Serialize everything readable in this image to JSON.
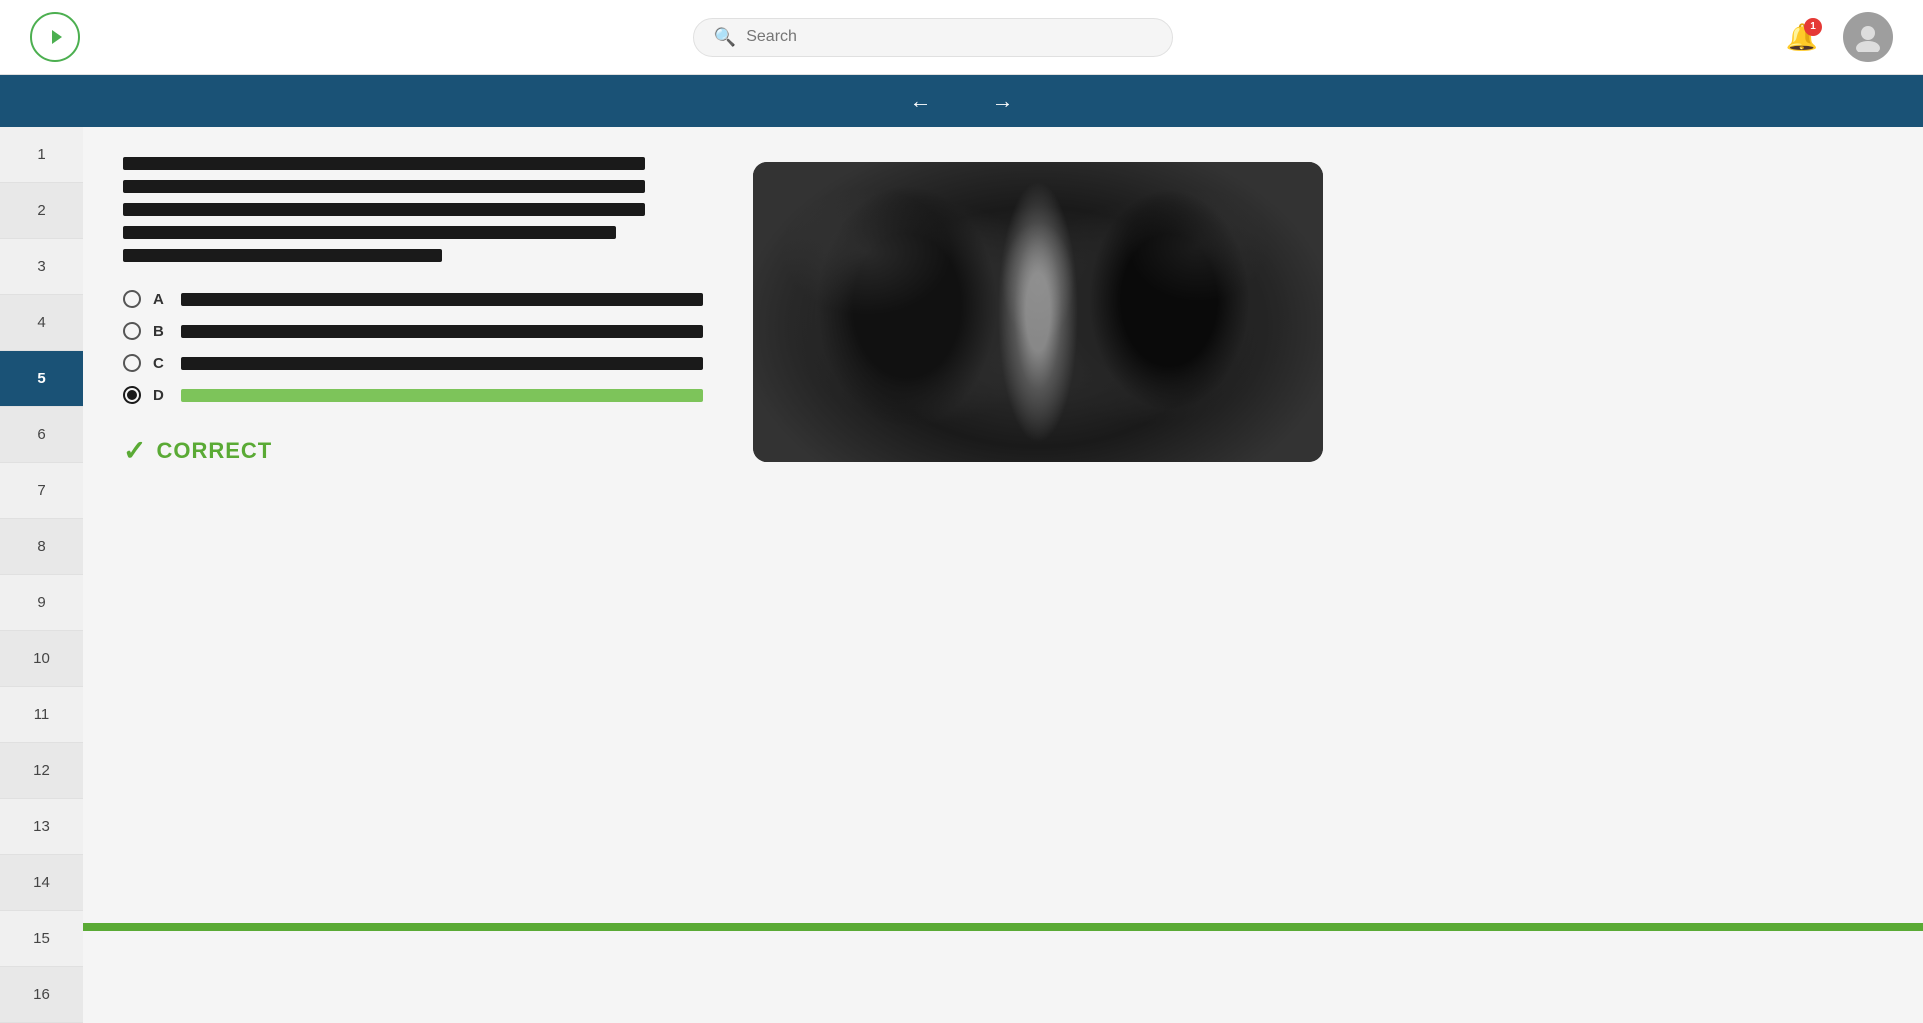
{
  "header": {
    "logo_icon": "play-icon",
    "search_placeholder": "Search",
    "notification_count": "1",
    "avatar_icon": "user-icon"
  },
  "nav": {
    "back_arrow": "←",
    "forward_arrow": "→"
  },
  "sidebar": {
    "items": [
      {
        "number": "1",
        "active": false
      },
      {
        "number": "2",
        "active": false
      },
      {
        "number": "3",
        "active": false
      },
      {
        "number": "4",
        "active": false
      },
      {
        "number": "5",
        "active": true
      },
      {
        "number": "6",
        "active": false
      },
      {
        "number": "7",
        "active": false
      },
      {
        "number": "8",
        "active": false
      },
      {
        "number": "9",
        "active": false
      },
      {
        "number": "10",
        "active": false
      },
      {
        "number": "11",
        "active": false
      },
      {
        "number": "12",
        "active": false
      },
      {
        "number": "13",
        "active": false
      },
      {
        "number": "14",
        "active": false
      },
      {
        "number": "15",
        "active": false
      },
      {
        "number": "16",
        "active": false
      }
    ]
  },
  "question": {
    "text_lines": [
      {
        "width": "90%"
      },
      {
        "width": "90%"
      },
      {
        "width": "90%"
      },
      {
        "width": "85%"
      },
      {
        "width": "55%"
      }
    ],
    "options": [
      {
        "label": "A",
        "selected": false,
        "correct": false,
        "bar_width": "85%"
      },
      {
        "label": "B",
        "selected": false,
        "correct": false,
        "bar_width": "85%"
      },
      {
        "label": "C",
        "selected": false,
        "correct": false,
        "bar_width": "85%"
      },
      {
        "label": "D",
        "selected": true,
        "correct": true,
        "bar_width": "85%"
      }
    ],
    "result_label": "CORRECT",
    "checkmark": "✓"
  }
}
